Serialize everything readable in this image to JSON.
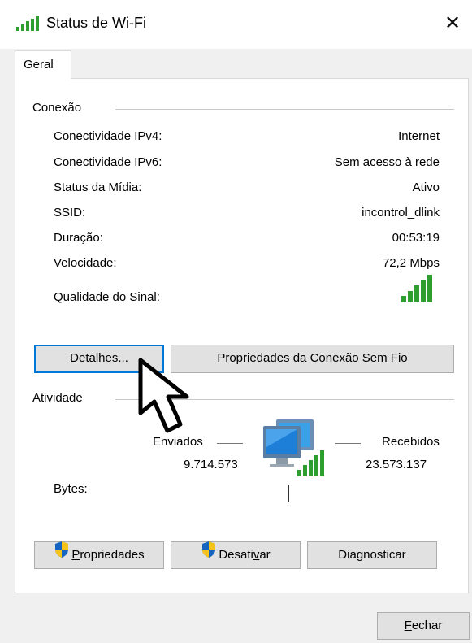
{
  "window": {
    "title": "Status de Wi-Fi",
    "close_glyph": "✕"
  },
  "tabs": [
    {
      "label": "Geral",
      "selected": true
    }
  ],
  "connection": {
    "title": "Conexão",
    "rows": [
      {
        "label": "Conectividade IPv4:",
        "value": "Internet"
      },
      {
        "label": "Conectividade IPv6:",
        "value": "Sem acesso à rede"
      },
      {
        "label": "Status da Mídia:",
        "value": "Ativo"
      },
      {
        "label": "SSID:",
        "value": "incontrol_dlink"
      },
      {
        "label": "Duração:",
        "value": "00:53:19"
      },
      {
        "label": "Velocidade:",
        "value": "72,2 Mbps"
      }
    ],
    "signal_label": "Qualidade do Sinal:",
    "signal_bars": 5
  },
  "buttons": {
    "details": {
      "pre": "",
      "key": "D",
      "post": "etalhes..."
    },
    "wireless_props": {
      "pre": "Propriedades da ",
      "key": "C",
      "post": "onexão Sem Fio"
    }
  },
  "activity": {
    "title": "Atividade",
    "sent_label": "Enviados",
    "received_label": "Recebidos",
    "bytes_label": "Bytes:",
    "bytes_sent": "9.714.573",
    "bytes_received": "23.573.137"
  },
  "bottom_buttons": {
    "properties": {
      "pre": "",
      "key": "P",
      "post": "ropriedades"
    },
    "disable": {
      "pre": "Desati",
      "key": "v",
      "post": "ar"
    },
    "diagnose": {
      "pre": "Dia",
      "key": "g",
      "post": "nosticar"
    }
  },
  "footer": {
    "close": {
      "pre": "",
      "key": "F",
      "post": "echar"
    }
  },
  "icons": [
    "wifi-signal-icon",
    "shield-icon",
    "network-computers-icon",
    "mouse-cursor-icon"
  ],
  "colors": {
    "accent": "#0078d7",
    "signal_green": "#2e9e2e"
  }
}
